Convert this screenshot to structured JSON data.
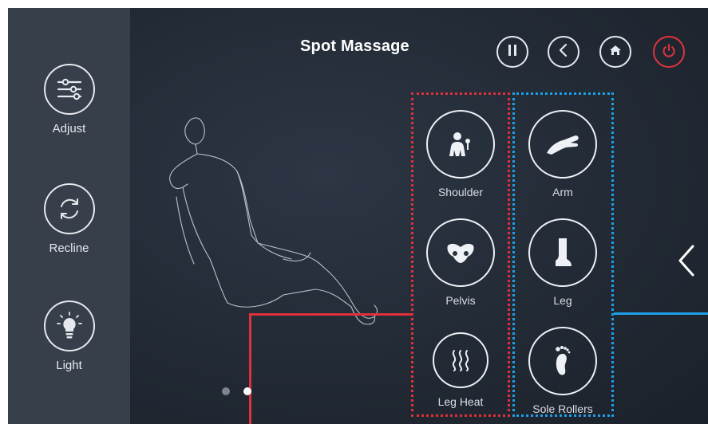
{
  "header": {
    "title": "Spot Massage"
  },
  "top_buttons": [
    {
      "name": "pause",
      "icon": "pause-icon"
    },
    {
      "name": "back",
      "icon": "chevron-left-icon"
    },
    {
      "name": "home",
      "icon": "home-icon"
    },
    {
      "name": "power",
      "icon": "power-icon",
      "color": "#e0343f"
    }
  ],
  "sidebar": {
    "items": [
      {
        "label": "Adjust",
        "icon": "sliders-icon"
      },
      {
        "label": "Recline",
        "icon": "recline-arrows-icon"
      },
      {
        "label": "Light",
        "icon": "lightbulb-icon"
      }
    ]
  },
  "zones": {
    "red_color": "#e0303a",
    "blue_color": "#1e9fe8",
    "left_column": [
      {
        "label": "Shoulder",
        "icon": "shoulder-icon"
      },
      {
        "label": "Pelvis",
        "icon": "pelvis-icon"
      },
      {
        "label": "Leg Heat",
        "icon": "heat-waves-icon"
      }
    ],
    "right_column": [
      {
        "label": "Arm",
        "icon": "arm-icon"
      },
      {
        "label": "Leg",
        "icon": "leg-boot-icon"
      },
      {
        "label": "Sole Rollers",
        "icon": "foot-icon"
      }
    ]
  },
  "pagination": {
    "pages": 2,
    "current": 2
  },
  "next_arrow": {
    "icon": "chevron-left-icon"
  }
}
